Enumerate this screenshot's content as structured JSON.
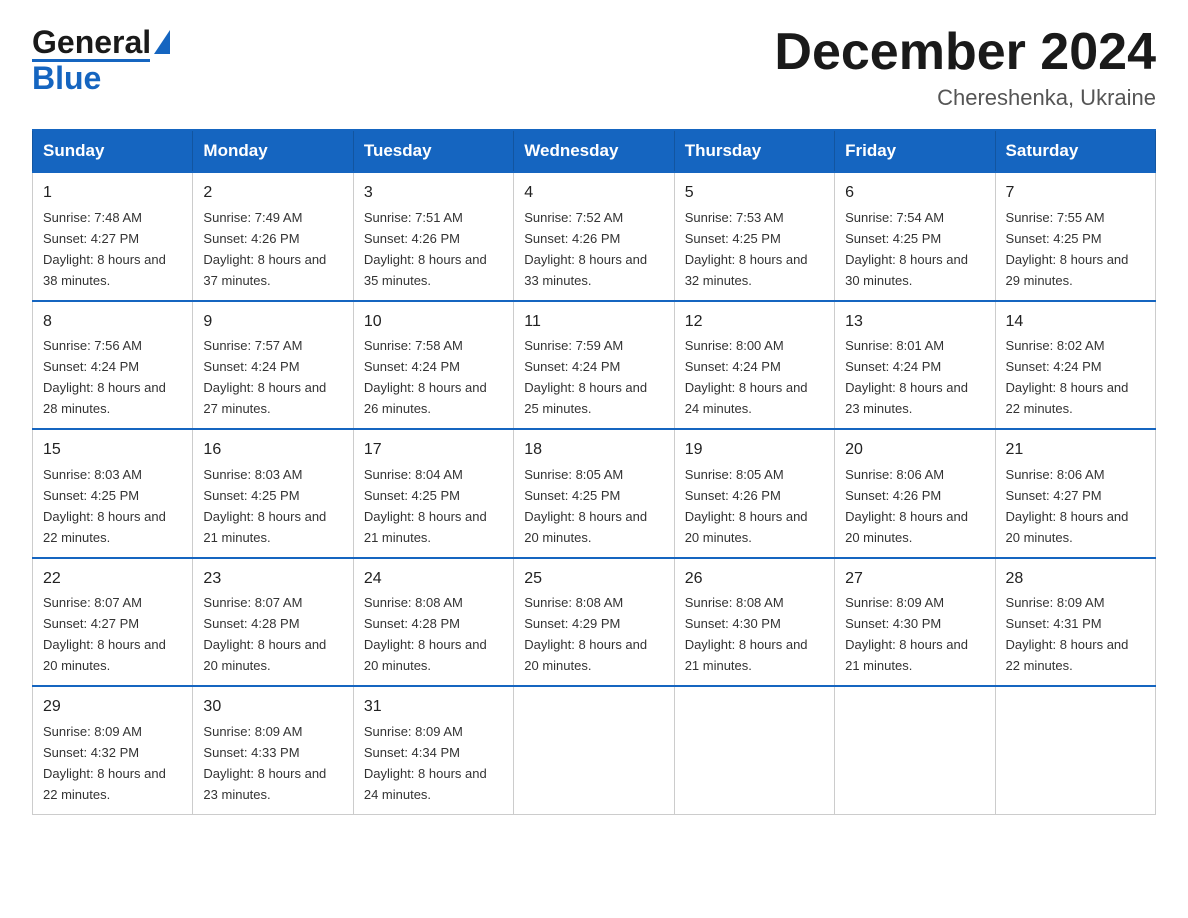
{
  "header": {
    "logo": {
      "general": "General",
      "blue": "Blue"
    },
    "title": "December 2024",
    "location": "Chereshenka, Ukraine"
  },
  "calendar": {
    "days_of_week": [
      "Sunday",
      "Monday",
      "Tuesday",
      "Wednesday",
      "Thursday",
      "Friday",
      "Saturday"
    ],
    "weeks": [
      [
        {
          "day": "1",
          "sunrise": "7:48 AM",
          "sunset": "4:27 PM",
          "daylight": "8 hours and 38 minutes."
        },
        {
          "day": "2",
          "sunrise": "7:49 AM",
          "sunset": "4:26 PM",
          "daylight": "8 hours and 37 minutes."
        },
        {
          "day": "3",
          "sunrise": "7:51 AM",
          "sunset": "4:26 PM",
          "daylight": "8 hours and 35 minutes."
        },
        {
          "day": "4",
          "sunrise": "7:52 AM",
          "sunset": "4:26 PM",
          "daylight": "8 hours and 33 minutes."
        },
        {
          "day": "5",
          "sunrise": "7:53 AM",
          "sunset": "4:25 PM",
          "daylight": "8 hours and 32 minutes."
        },
        {
          "day": "6",
          "sunrise": "7:54 AM",
          "sunset": "4:25 PM",
          "daylight": "8 hours and 30 minutes."
        },
        {
          "day": "7",
          "sunrise": "7:55 AM",
          "sunset": "4:25 PM",
          "daylight": "8 hours and 29 minutes."
        }
      ],
      [
        {
          "day": "8",
          "sunrise": "7:56 AM",
          "sunset": "4:24 PM",
          "daylight": "8 hours and 28 minutes."
        },
        {
          "day": "9",
          "sunrise": "7:57 AM",
          "sunset": "4:24 PM",
          "daylight": "8 hours and 27 minutes."
        },
        {
          "day": "10",
          "sunrise": "7:58 AM",
          "sunset": "4:24 PM",
          "daylight": "8 hours and 26 minutes."
        },
        {
          "day": "11",
          "sunrise": "7:59 AM",
          "sunset": "4:24 PM",
          "daylight": "8 hours and 25 minutes."
        },
        {
          "day": "12",
          "sunrise": "8:00 AM",
          "sunset": "4:24 PM",
          "daylight": "8 hours and 24 minutes."
        },
        {
          "day": "13",
          "sunrise": "8:01 AM",
          "sunset": "4:24 PM",
          "daylight": "8 hours and 23 minutes."
        },
        {
          "day": "14",
          "sunrise": "8:02 AM",
          "sunset": "4:24 PM",
          "daylight": "8 hours and 22 minutes."
        }
      ],
      [
        {
          "day": "15",
          "sunrise": "8:03 AM",
          "sunset": "4:25 PM",
          "daylight": "8 hours and 22 minutes."
        },
        {
          "day": "16",
          "sunrise": "8:03 AM",
          "sunset": "4:25 PM",
          "daylight": "8 hours and 21 minutes."
        },
        {
          "day": "17",
          "sunrise": "8:04 AM",
          "sunset": "4:25 PM",
          "daylight": "8 hours and 21 minutes."
        },
        {
          "day": "18",
          "sunrise": "8:05 AM",
          "sunset": "4:25 PM",
          "daylight": "8 hours and 20 minutes."
        },
        {
          "day": "19",
          "sunrise": "8:05 AM",
          "sunset": "4:26 PM",
          "daylight": "8 hours and 20 minutes."
        },
        {
          "day": "20",
          "sunrise": "8:06 AM",
          "sunset": "4:26 PM",
          "daylight": "8 hours and 20 minutes."
        },
        {
          "day": "21",
          "sunrise": "8:06 AM",
          "sunset": "4:27 PM",
          "daylight": "8 hours and 20 minutes."
        }
      ],
      [
        {
          "day": "22",
          "sunrise": "8:07 AM",
          "sunset": "4:27 PM",
          "daylight": "8 hours and 20 minutes."
        },
        {
          "day": "23",
          "sunrise": "8:07 AM",
          "sunset": "4:28 PM",
          "daylight": "8 hours and 20 minutes."
        },
        {
          "day": "24",
          "sunrise": "8:08 AM",
          "sunset": "4:28 PM",
          "daylight": "8 hours and 20 minutes."
        },
        {
          "day": "25",
          "sunrise": "8:08 AM",
          "sunset": "4:29 PM",
          "daylight": "8 hours and 20 minutes."
        },
        {
          "day": "26",
          "sunrise": "8:08 AM",
          "sunset": "4:30 PM",
          "daylight": "8 hours and 21 minutes."
        },
        {
          "day": "27",
          "sunrise": "8:09 AM",
          "sunset": "4:30 PM",
          "daylight": "8 hours and 21 minutes."
        },
        {
          "day": "28",
          "sunrise": "8:09 AM",
          "sunset": "4:31 PM",
          "daylight": "8 hours and 22 minutes."
        }
      ],
      [
        {
          "day": "29",
          "sunrise": "8:09 AM",
          "sunset": "4:32 PM",
          "daylight": "8 hours and 22 minutes."
        },
        {
          "day": "30",
          "sunrise": "8:09 AM",
          "sunset": "4:33 PM",
          "daylight": "8 hours and 23 minutes."
        },
        {
          "day": "31",
          "sunrise": "8:09 AM",
          "sunset": "4:34 PM",
          "daylight": "8 hours and 24 minutes."
        },
        null,
        null,
        null,
        null
      ]
    ]
  }
}
